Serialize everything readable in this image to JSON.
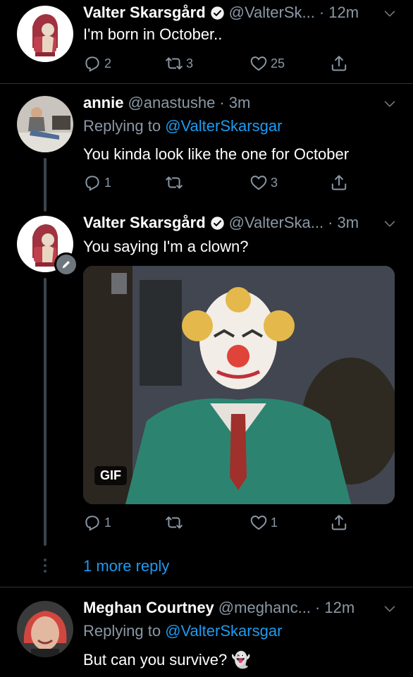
{
  "tweets": [
    {
      "name": "Valter Skarsgård",
      "handle": "@ValterSk...",
      "time": "· 12m",
      "text": "I'm born in October..",
      "reply_count": "2",
      "retweet_count": "3",
      "like_count": "25"
    },
    {
      "name": "annie",
      "handle": "@anastushe",
      "time": "· 3m",
      "replying_prefix": "Replying to ",
      "replying_to": "@ValterSkarsgar",
      "text": "You kinda look like the one for October",
      "reply_count": "1",
      "retweet_count": "",
      "like_count": "3"
    },
    {
      "name": "Valter Skarsgård",
      "handle": "@ValterSka...",
      "time": "· 3m",
      "text": "You saying I'm a clown?",
      "gif_label": "GIF",
      "reply_count": "1",
      "retweet_count": "",
      "like_count": "1"
    },
    {
      "name": "Meghan Courtney",
      "handle": "@meghanc...",
      "time": "· 12m",
      "replying_prefix": "Replying to ",
      "replying_to": "@ValterSkarsgar",
      "text": "But can you survive?",
      "emoji": "👻"
    }
  ],
  "more_replies": "1 more reply",
  "colors": {
    "background": "#000000",
    "link": "#1d9bf0",
    "secondary_text": "#8b98a5"
  },
  "icons": [
    "reply-icon",
    "retweet-icon",
    "like-icon",
    "share-icon",
    "chevron-down-icon",
    "verified-badge-icon",
    "edit-pencil-icon",
    "more-dots-icon"
  ]
}
